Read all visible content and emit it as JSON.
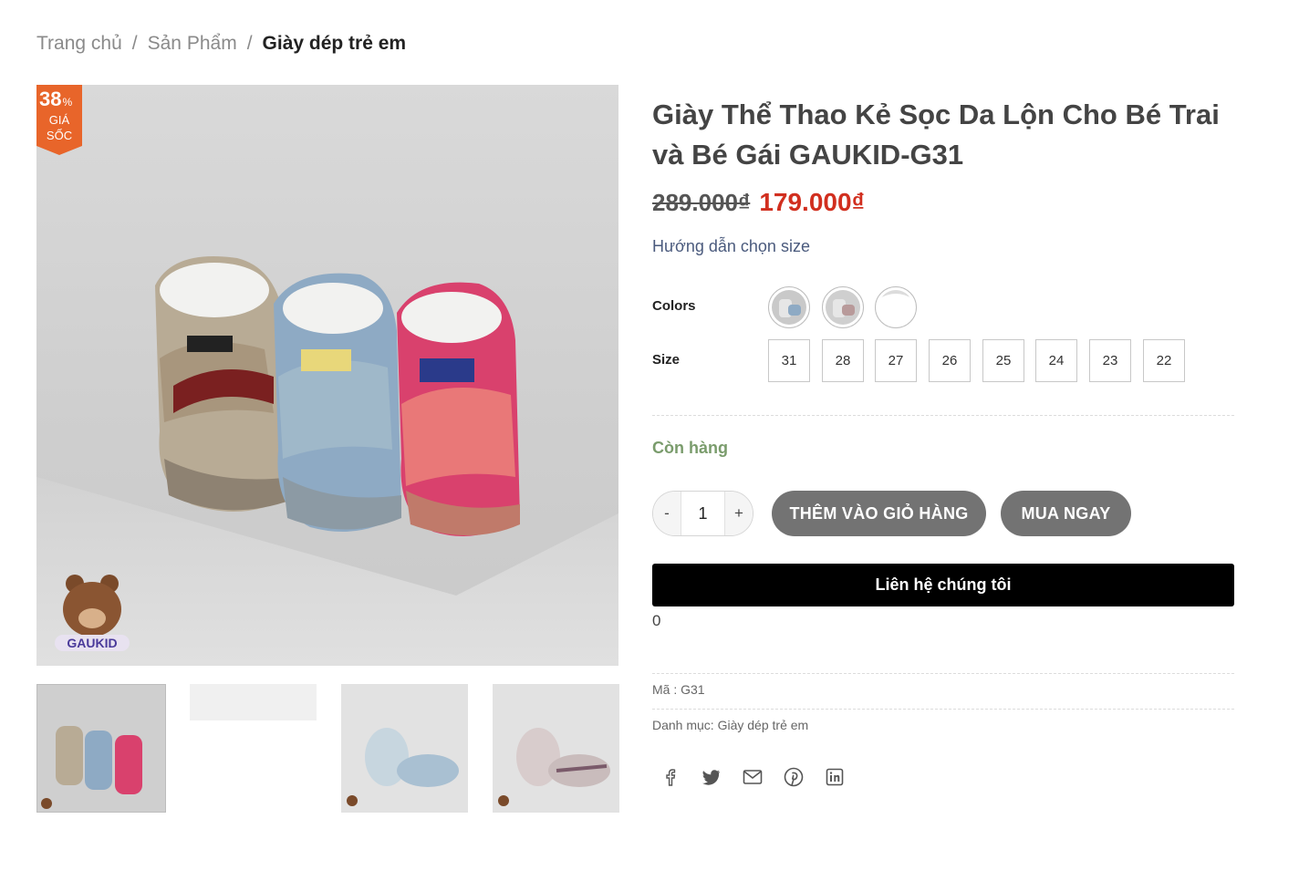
{
  "breadcrumb": {
    "home": "Trang chủ",
    "products": "Sản Phẩm",
    "current": "Giày dép trẻ em",
    "separator": "/"
  },
  "badge": {
    "percent": "38",
    "percent_sign": "%",
    "line1": "GIÁ",
    "line2": "SỐC",
    "color": "#e8652a"
  },
  "product": {
    "title": "Giày Thể Thao Kẻ Sọc Da Lộn Cho Bé Trai và Bé Gái GAUKID-G31",
    "old_price": "289.000₫",
    "new_price": "179.000₫",
    "size_guide": "Hướng dẫn chọn size",
    "stock": "Còn hàng",
    "sku_label": "Mã : ",
    "sku": "G31",
    "category_label": "Danh mục: ",
    "category": "Giày dép trẻ em",
    "zero_text": "0"
  },
  "options": {
    "colors_label": "Colors",
    "size_label": "Size",
    "sizes": [
      "31",
      "28",
      "27",
      "26",
      "25",
      "24",
      "23",
      "22"
    ]
  },
  "cart": {
    "minus": "-",
    "quantity": "1",
    "plus": "+",
    "add_to_cart": "THÊM VÀO GIỎ HÀNG",
    "buy_now": "MUA NGAY",
    "contact": "Liên hệ chúng tôi"
  },
  "share": [
    "facebook-icon",
    "twitter-icon",
    "email-icon",
    "pinterest-icon",
    "linkedin-icon"
  ],
  "logo_text": "GAUKID",
  "colors": {
    "price_red": "#d12f1f",
    "stock_green": "#7a9c6c",
    "button_grey": "#737373",
    "link_blue": "#4a5a7d"
  }
}
